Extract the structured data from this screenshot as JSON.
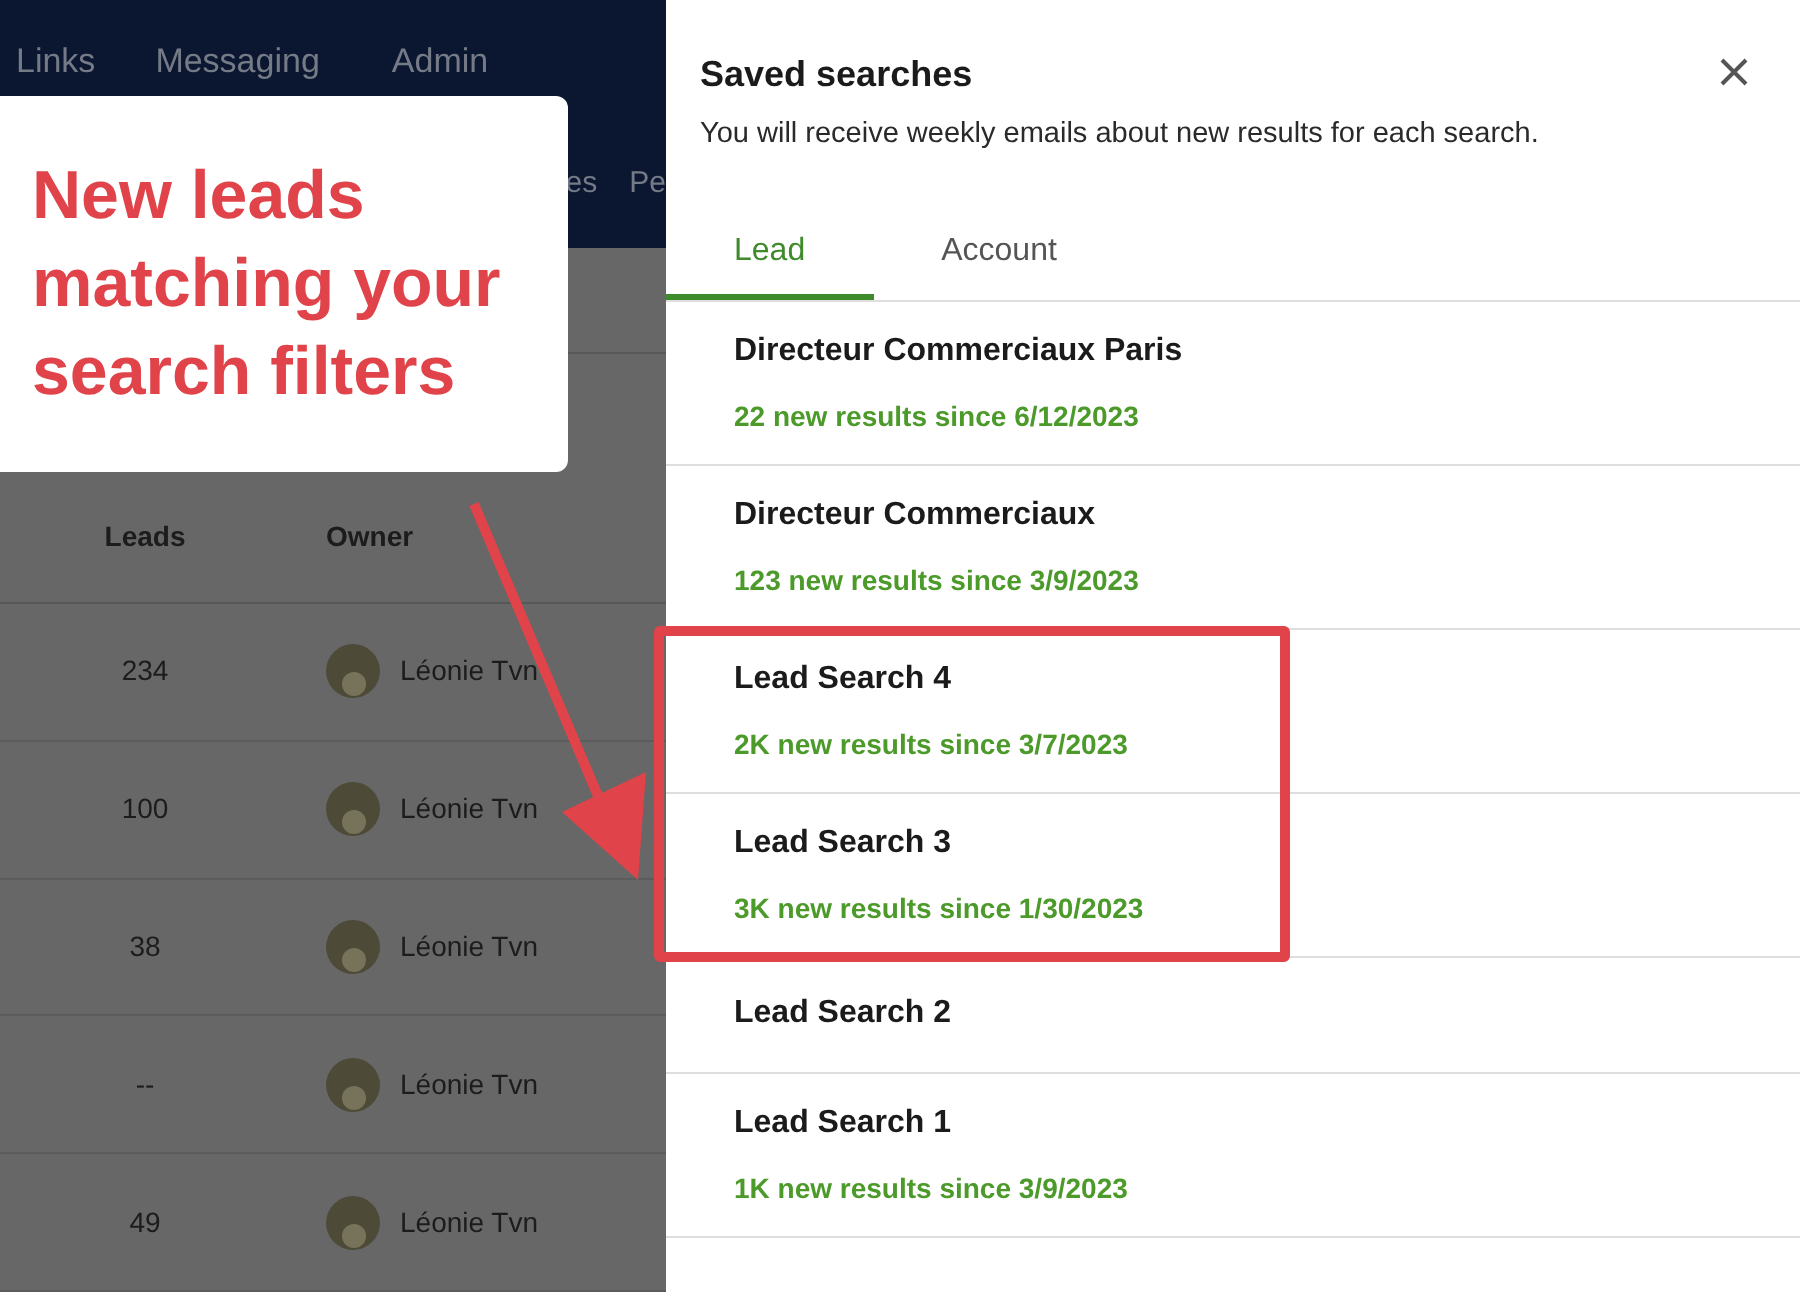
{
  "top_nav": {
    "items": [
      "Links",
      "Messaging",
      "Admin"
    ]
  },
  "sub_nav": {
    "items": [
      "es",
      "Pe"
    ]
  },
  "table": {
    "columns": [
      "Leads",
      "Owner"
    ],
    "rows": [
      {
        "leads": "234",
        "owner": "Léonie Tvn"
      },
      {
        "leads": "100",
        "owner": "Léonie Tvn"
      },
      {
        "leads": "38",
        "owner": "Léonie Tvn"
      },
      {
        "leads": "--",
        "owner": "Léonie Tvn"
      },
      {
        "leads": "49",
        "owner": "Léonie Tvn"
      }
    ]
  },
  "annotation": {
    "text": "New leads matching your search filters"
  },
  "panel": {
    "title": "Saved searches",
    "subtitle": "You will receive weekly emails about new results for each search.",
    "tabs": [
      {
        "label": "Lead",
        "selected": true
      },
      {
        "label": "Account",
        "selected": false
      }
    ],
    "searches": [
      {
        "name": "Directeur Commerciaux Paris",
        "results": "22 new results since 6/12/2023",
        "highlighted": false
      },
      {
        "name": "Directeur Commerciaux",
        "results": "123 new results since 3/9/2023",
        "highlighted": false
      },
      {
        "name": "Lead Search 4",
        "results": "2K new results since 3/7/2023",
        "highlighted": true
      },
      {
        "name": "Lead Search 3",
        "results": "3K new results since 1/30/2023",
        "highlighted": true
      },
      {
        "name": "Lead Search 2",
        "highlighted": false
      },
      {
        "name": "Lead Search 1",
        "results": "1K new results since 3/9/2023",
        "highlighted": false
      }
    ]
  }
}
